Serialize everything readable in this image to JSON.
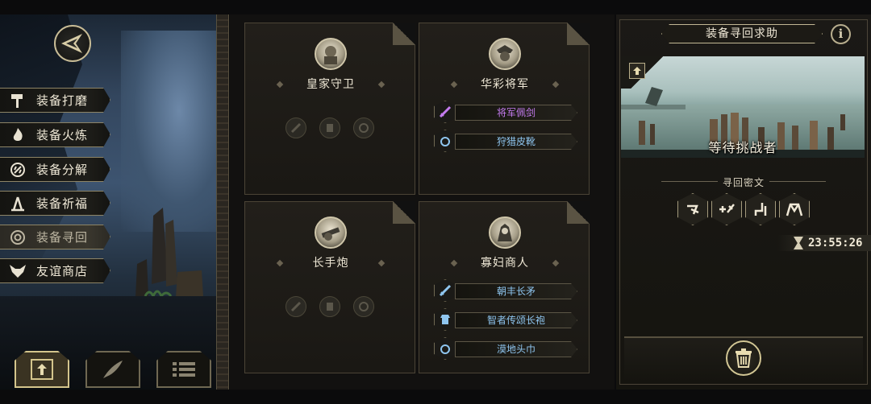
{
  "menu": {
    "items": [
      {
        "label": "装备打磨",
        "icon": "hammer-icon"
      },
      {
        "label": "装备火炼",
        "icon": "flame-icon"
      },
      {
        "label": "装备分解",
        "icon": "disassemble-icon"
      },
      {
        "label": "装备祈福",
        "icon": "pray-icon"
      },
      {
        "label": "装备寻回",
        "icon": "retrieve-icon",
        "active": true
      },
      {
        "label": "友谊商店",
        "icon": "fox-icon"
      }
    ]
  },
  "cards": [
    {
      "name": "皇家守卫",
      "portrait": "guard-portrait"
    },
    {
      "name": "华彩将军",
      "portrait": "general-portrait",
      "items": [
        {
          "label": "将军佩剑",
          "color": "#c57cf0",
          "icon": "sword-icon"
        },
        {
          "label": "狩猎皮靴",
          "color": "#8fc6f0",
          "icon": "ring-icon"
        }
      ]
    },
    {
      "name": "长手炮",
      "portrait": "cannon-portrait"
    },
    {
      "name": "寡妇商人",
      "portrait": "merchant-portrait",
      "items": [
        {
          "label": "朝丰长矛",
          "color": "#8fc6f0",
          "icon": "sword-icon"
        },
        {
          "label": "智者传颂长袍",
          "color": "#8fc6f0",
          "icon": "armor-icon"
        },
        {
          "label": "漠地头巾",
          "color": "#8fc6f0",
          "icon": "ring-icon"
        }
      ]
    }
  ],
  "panel": {
    "title": "装备寻回求助",
    "info": "i",
    "status": "等待挑战者",
    "cipher_label": "寻回密文",
    "timer": "23:55:26"
  },
  "colors": {
    "gold": "#c8bc96",
    "rare_blue": "#8fc6f0",
    "epic_purple": "#c57cf0"
  }
}
